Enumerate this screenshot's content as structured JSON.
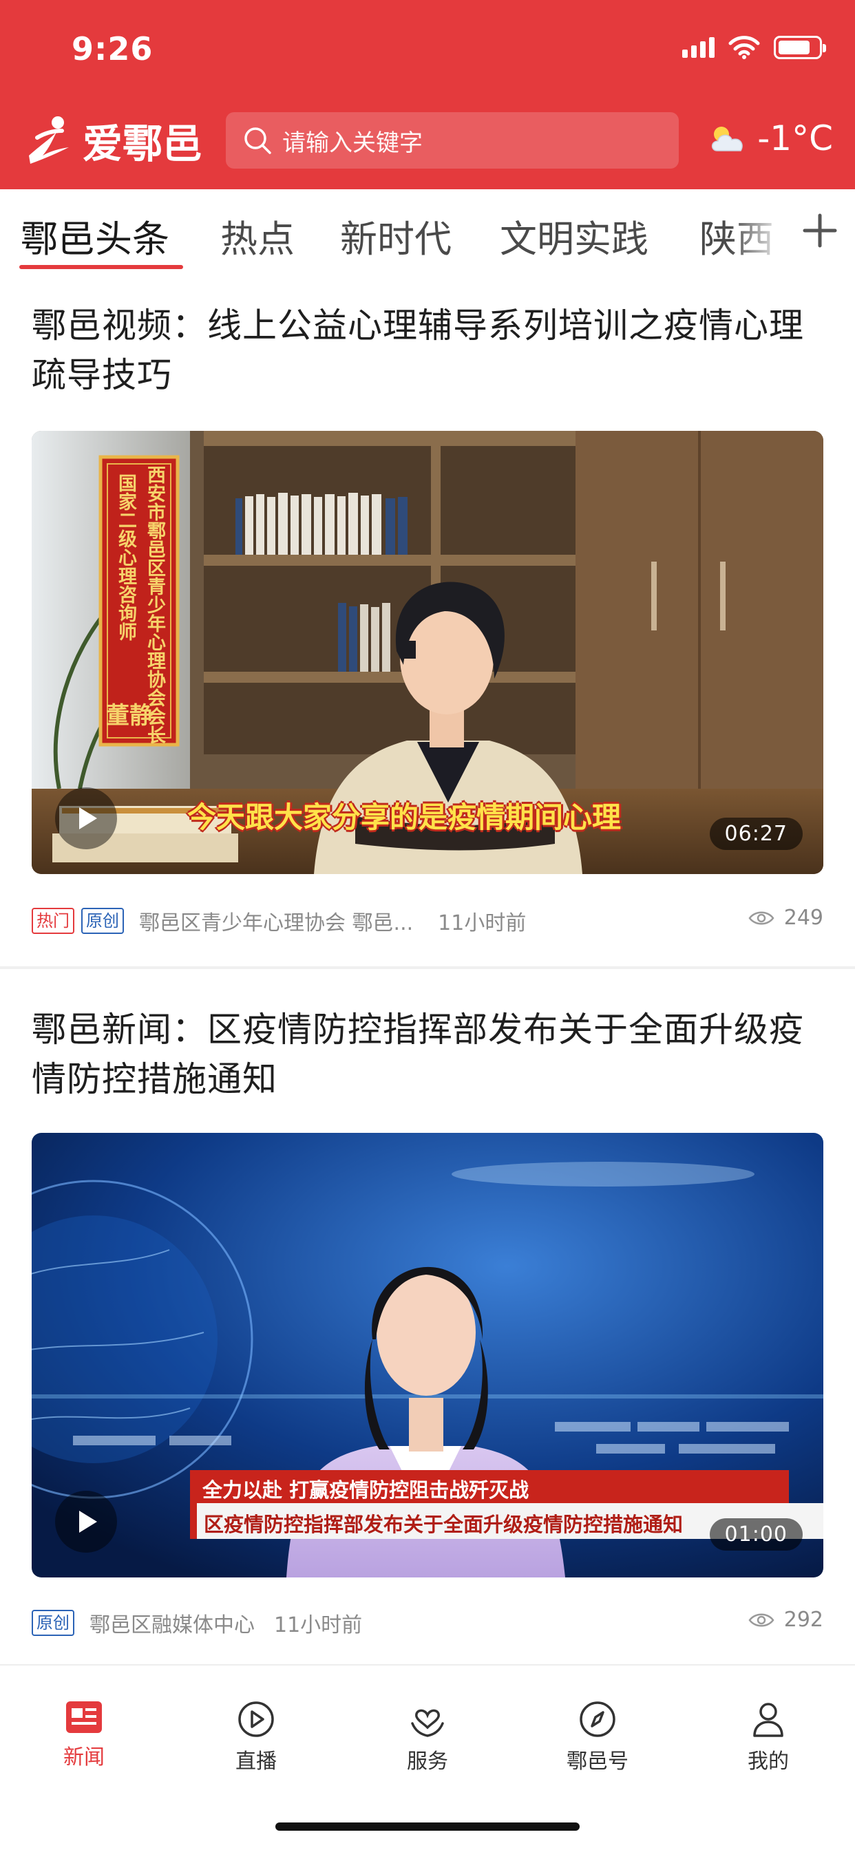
{
  "status_bar": {
    "time": "9:26",
    "battery_level": 0.8
  },
  "header": {
    "logo_text": "爱鄠邑",
    "search_placeholder": "请输入关键字",
    "weather_temp": "-1°C",
    "weather_icon": "cloudy-icon"
  },
  "tabs": [
    {
      "label": "鄠邑头条",
      "active": true
    },
    {
      "label": "热点",
      "active": false
    },
    {
      "label": "新时代",
      "active": false
    },
    {
      "label": "文明实践",
      "active": false
    },
    {
      "label": "陕西",
      "active": false
    }
  ],
  "articles": [
    {
      "title": "鄠邑视频：线上公益心理辅导系列培训之疫情心理疏导技巧",
      "banner_text": "西安市鄠邑区青少年心理协会会长",
      "banner_text2": "国家二级心理咨询师",
      "banner_name": "董静",
      "subtitle": "今天跟大家分享的是疫情期间心理",
      "duration": "06:27",
      "tags": [
        "热门",
        "原创"
      ],
      "source": "鄠邑区青少年心理协会 鄠邑...",
      "time": "11小时前",
      "views": "249"
    },
    {
      "title": "鄠邑新闻：区疫情防控指挥部发布关于全面升级疫情防控措施通知",
      "lower_third_1": "全力以赴 打赢疫情防控阻击战歼灭战",
      "lower_third_2": "区疫情防控指挥部发布关于全面升级疫情防控措施通知",
      "duration": "01:00",
      "tags": [
        "原创"
      ],
      "source": "鄠邑区融媒体中心",
      "time": "11小时前",
      "views": "292"
    }
  ],
  "bottom_nav": [
    {
      "label": "新闻",
      "icon": "news-icon",
      "active": true
    },
    {
      "label": "直播",
      "icon": "live-play-icon",
      "active": false
    },
    {
      "label": "服务",
      "icon": "service-heart-icon",
      "active": false
    },
    {
      "label": "鄠邑号",
      "icon": "compass-icon",
      "active": false
    },
    {
      "label": "我的",
      "icon": "user-icon",
      "active": false
    }
  ],
  "colors": {
    "brand_red": "#e43a3d",
    "tag_blue": "#2b63b6",
    "meta_gray": "#8a8a8a"
  }
}
